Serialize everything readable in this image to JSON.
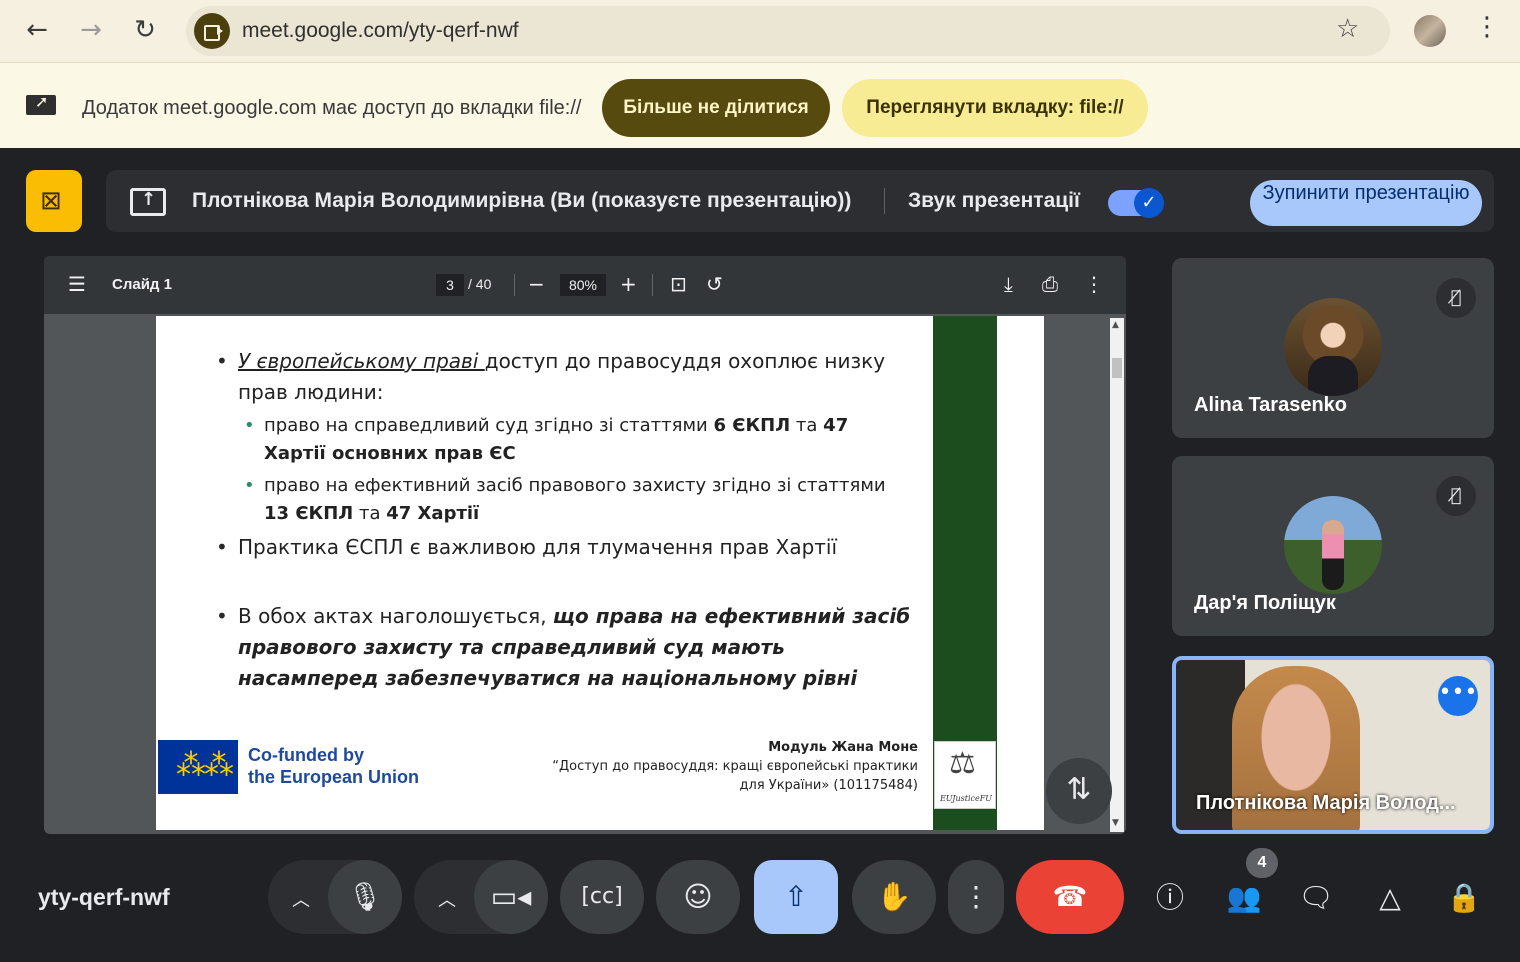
{
  "browser": {
    "url": "meet.google.com/yty-qerf-nwf",
    "back_icon": "arrow-back-icon",
    "forward_icon": "arrow-forward-icon",
    "reload_icon": "reload-icon"
  },
  "infobar": {
    "message": "Додаток meet.google.com має доступ до вкладки file://",
    "stop_sharing_label": "Більше не ділитися",
    "view_tab_label": "Переглянути вкладку: file://"
  },
  "banner": {
    "presenter": "Плотнікова Марія Володимирівна (Ви (показуєте презентацію))",
    "audio_label": "Звук презентації",
    "audio_enabled": true,
    "stop_label": "Зупинити презентацію"
  },
  "viewer": {
    "title": "Слайд 1",
    "page_current": "3",
    "page_total": "/ 40",
    "zoom": "80%"
  },
  "slide": {
    "bullet1_underlined": "У європейському праві ",
    "bullet1_rest": "доступ до правосуддя охоплює низку прав людини:",
    "sub1_text": "право на справедливий суд згідно зі статтями ",
    "sub1_bold1": "6 ЄКПЛ",
    "sub1_mid": " та ",
    "sub1_bold2": "47 Хартії основних прав ЄС",
    "sub2_text": "право на ефективний засіб правового захисту згідно зі статтями ",
    "sub2_bold1": "13 ЄКПЛ",
    "sub2_mid": " та ",
    "sub2_bold2": "47 Хартії",
    "bullet2": "Практика ЄСПЛ є важливою для тлумачення прав Хартії",
    "bullet3_lead": "В обох актах наголошується, ",
    "bullet3_emph": "що права на ефективний засіб правового захисту та справедливий суд мають насамперед забезпечуватися на національному рівні",
    "cofunded_line1": "Co-funded by",
    "cofunded_line2": "the European Union",
    "module_title": "Модуль Жана Моне",
    "module_line1": "“Доступ до правосуддя:  кращі європейські практики",
    "module_line2": "для України» (101175484)",
    "logo_text": "EUJusticeFU"
  },
  "participants": [
    {
      "name": "Alina Tarasenko",
      "muted": true
    },
    {
      "name": "Дар'я Поліщук",
      "muted": true
    },
    {
      "name": "Плотнікова Марія Волод..."
    }
  ],
  "controls": {
    "meeting_code": "yty-qerf-nwf",
    "people_count": "4",
    "accent_hangup": "#ea4335",
    "accent_share": "#a8c7fa"
  }
}
